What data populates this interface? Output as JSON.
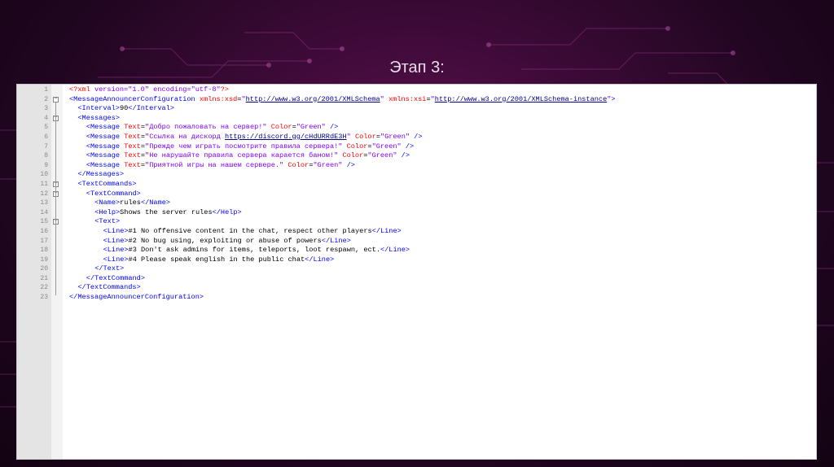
{
  "slide": {
    "title": "Этап 3:"
  },
  "editor": {
    "lines": [
      {
        "num": "1",
        "indent": 0,
        "parts": [
          [
            "pi",
            "<?xml "
          ],
          [
            "pa",
            "version=\"1.0\" encoding=\"utf-8\""
          ],
          [
            "pi",
            "?>"
          ]
        ]
      },
      {
        "num": "2",
        "indent": 0,
        "parts": [
          [
            "t",
            "<MessageAnnouncerConfiguration "
          ],
          [
            "a",
            "xmlns:xsd"
          ],
          [
            "k",
            "="
          ],
          [
            "v",
            "\""
          ],
          [
            "u",
            "http://www.w3.org/2001/XMLSchema"
          ],
          [
            "v",
            "\""
          ],
          [
            "k",
            " "
          ],
          [
            "a",
            "xmlns:xsi"
          ],
          [
            "k",
            "="
          ],
          [
            "v",
            "\""
          ],
          [
            "u",
            "http://www.w3.org/2001/XMLSchema-instance"
          ],
          [
            "v",
            "\""
          ],
          [
            "t",
            ">"
          ]
        ]
      },
      {
        "num": "3",
        "indent": 1,
        "parts": [
          [
            "t",
            "<Interval>"
          ],
          [
            "k",
            "90"
          ],
          [
            "t",
            "</Interval>"
          ]
        ]
      },
      {
        "num": "4",
        "indent": 1,
        "parts": [
          [
            "t",
            "<Messages>"
          ]
        ]
      },
      {
        "num": "5",
        "indent": 2,
        "parts": [
          [
            "t",
            "<Message "
          ],
          [
            "a",
            "Text"
          ],
          [
            "k",
            "="
          ],
          [
            "v",
            "\"Добро пожаловать на сервер!\""
          ],
          [
            "k",
            " "
          ],
          [
            "a",
            "Color"
          ],
          [
            "k",
            "="
          ],
          [
            "v",
            "\"Green\""
          ],
          [
            "t",
            " />"
          ]
        ]
      },
      {
        "num": "6",
        "indent": 2,
        "parts": [
          [
            "t",
            "<Message "
          ],
          [
            "a",
            "Text"
          ],
          [
            "k",
            "="
          ],
          [
            "v",
            "\"Ссылка на дискорд "
          ],
          [
            "u",
            "https://discord.gg/cHdURRdE3H"
          ],
          [
            "v",
            "\""
          ],
          [
            "k",
            " "
          ],
          [
            "a",
            "Color"
          ],
          [
            "k",
            "="
          ],
          [
            "v",
            "\"Green\""
          ],
          [
            "t",
            " />"
          ]
        ]
      },
      {
        "num": "7",
        "indent": 2,
        "parts": [
          [
            "t",
            "<Message "
          ],
          [
            "a",
            "Text"
          ],
          [
            "k",
            "="
          ],
          [
            "v",
            "\"Прежде чем играть посмотрите правила сервера!\""
          ],
          [
            "k",
            " "
          ],
          [
            "a",
            "Color"
          ],
          [
            "k",
            "="
          ],
          [
            "v",
            "\"Green\""
          ],
          [
            "t",
            " />"
          ]
        ]
      },
      {
        "num": "8",
        "indent": 2,
        "parts": [
          [
            "t",
            "<Message "
          ],
          [
            "a",
            "Text"
          ],
          [
            "k",
            "="
          ],
          [
            "v",
            "\"Не нарушайте правила сервера карается баном!\""
          ],
          [
            "k",
            " "
          ],
          [
            "a",
            "Color"
          ],
          [
            "k",
            "="
          ],
          [
            "v",
            "\"Green\""
          ],
          [
            "t",
            " />"
          ]
        ]
      },
      {
        "num": "9",
        "indent": 2,
        "parts": [
          [
            "t",
            "<Message "
          ],
          [
            "a",
            "Text"
          ],
          [
            "k",
            "="
          ],
          [
            "v",
            "\"Приятной игры на нашем сервере.\""
          ],
          [
            "k",
            " "
          ],
          [
            "a",
            "Color"
          ],
          [
            "k",
            "="
          ],
          [
            "v",
            "\"Green\""
          ],
          [
            "t",
            " />"
          ]
        ]
      },
      {
        "num": "10",
        "indent": 1,
        "parts": [
          [
            "t",
            "</Messages>"
          ]
        ]
      },
      {
        "num": "11",
        "indent": 1,
        "parts": [
          [
            "t",
            "<TextCommands>"
          ]
        ]
      },
      {
        "num": "12",
        "indent": 2,
        "parts": [
          [
            "t",
            "<TextCommand>"
          ]
        ]
      },
      {
        "num": "13",
        "indent": 3,
        "parts": [
          [
            "t",
            "<Name>"
          ],
          [
            "k",
            "rules"
          ],
          [
            "t",
            "</Name>"
          ]
        ]
      },
      {
        "num": "14",
        "indent": 3,
        "parts": [
          [
            "t",
            "<Help>"
          ],
          [
            "k",
            "Shows the server rules"
          ],
          [
            "t",
            "</Help>"
          ]
        ]
      },
      {
        "num": "15",
        "indent": 3,
        "parts": [
          [
            "t",
            "<Text>"
          ]
        ]
      },
      {
        "num": "16",
        "indent": 4,
        "parts": [
          [
            "t",
            "<Line>"
          ],
          [
            "k",
            "#1 No offensive content in the chat, respect other players"
          ],
          [
            "t",
            "</Line>"
          ]
        ]
      },
      {
        "num": "17",
        "indent": 4,
        "parts": [
          [
            "t",
            "<Line>"
          ],
          [
            "k",
            "#2 No bug using, exploiting or abuse of powers"
          ],
          [
            "t",
            "</Line>"
          ]
        ]
      },
      {
        "num": "18",
        "indent": 4,
        "parts": [
          [
            "t",
            "<Line>"
          ],
          [
            "k",
            "#3 Don't ask admins for items, teleports, loot respawn, ect."
          ],
          [
            "t",
            "</Line>"
          ]
        ]
      },
      {
        "num": "19",
        "indent": 4,
        "parts": [
          [
            "t",
            "<Line>"
          ],
          [
            "k",
            "#4 Please speak english in the public chat"
          ],
          [
            "t",
            "</Line>"
          ]
        ]
      },
      {
        "num": "20",
        "indent": 3,
        "parts": [
          [
            "t",
            "</Text>"
          ]
        ]
      },
      {
        "num": "21",
        "indent": 2,
        "parts": [
          [
            "t",
            "</TextCommand>"
          ]
        ]
      },
      {
        "num": "22",
        "indent": 1,
        "parts": [
          [
            "t",
            "</TextCommands>"
          ]
        ]
      },
      {
        "num": "23",
        "indent": 0,
        "parts": [
          [
            "t",
            "</MessageAnnouncerConfiguration>"
          ]
        ]
      }
    ],
    "fold_markers": [
      "2",
      "4",
      "11",
      "12",
      "15"
    ],
    "fold_symbol": "−"
  }
}
